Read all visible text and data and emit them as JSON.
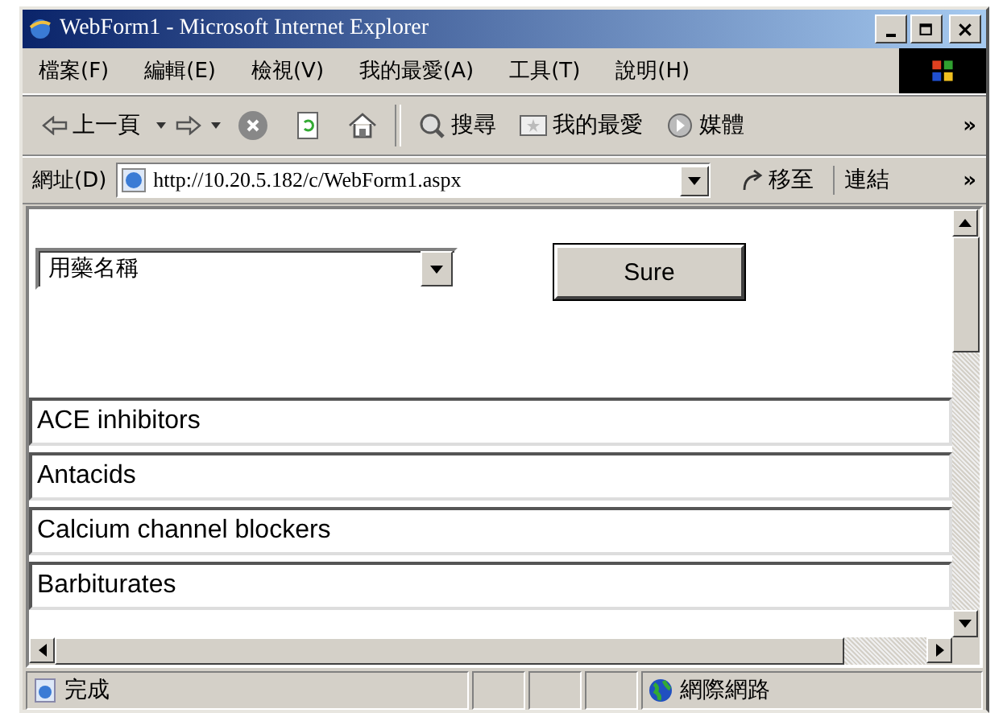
{
  "window": {
    "title": "WebForm1 - Microsoft Internet Explorer"
  },
  "menu": [
    "檔案(F)",
    "編輯(E)",
    "檢視(V)",
    "我的最愛(A)",
    "工具(T)",
    "說明(H)"
  ],
  "toolbar": {
    "back": "上一頁",
    "search": "搜尋",
    "favorites": "我的最愛",
    "media": "媒體",
    "more": "»"
  },
  "address": {
    "label": "網址(D)",
    "url": "http://10.20.5.182/c/WebForm1.aspx",
    "go": "移至",
    "links": "連結",
    "more": "»"
  },
  "form": {
    "select_value": "用藥名稱",
    "button": "Sure"
  },
  "list": [
    "ACE inhibitors",
    "Antacids",
    "Calcium channel blockers",
    "Barbiturates"
  ],
  "status_bar": {
    "text": "完成",
    "zone": "網際網路"
  }
}
